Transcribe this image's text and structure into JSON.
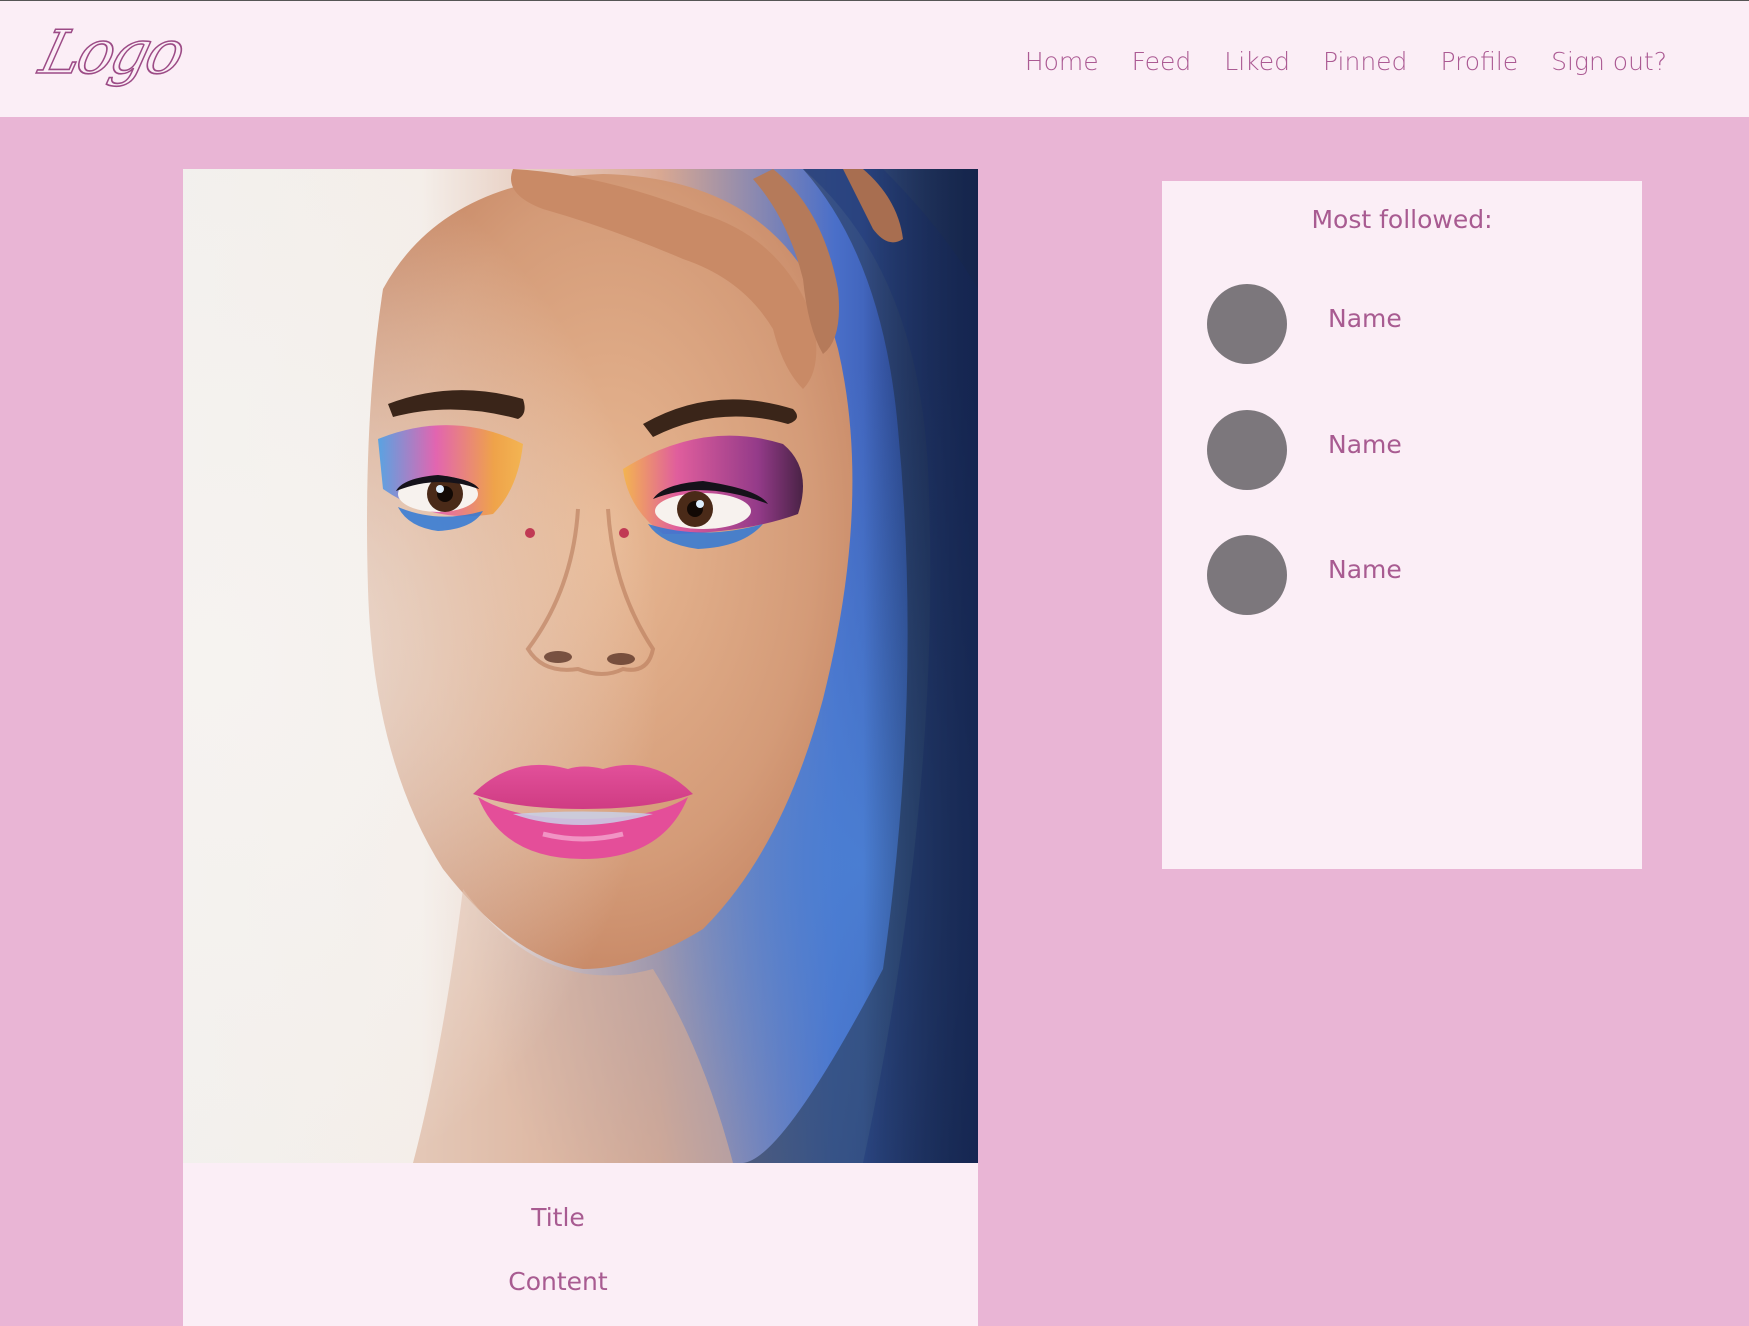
{
  "header": {
    "logo_text": "Logo",
    "nav": [
      "Home",
      "Feed",
      "Liked",
      "Pinned",
      "Profile",
      "Sign out?"
    ]
  },
  "post": {
    "title": "Title",
    "content": "Content"
  },
  "most_followed": {
    "heading": "Most followed:",
    "users": [
      {
        "name": "Name"
      },
      {
        "name": "Name"
      },
      {
        "name": "Name"
      }
    ]
  },
  "colors": {
    "page_background": "#e9b5d5",
    "panel_background": "#fbeef6",
    "text_accent": "#a85b91",
    "avatar_placeholder": "#7c777c"
  }
}
